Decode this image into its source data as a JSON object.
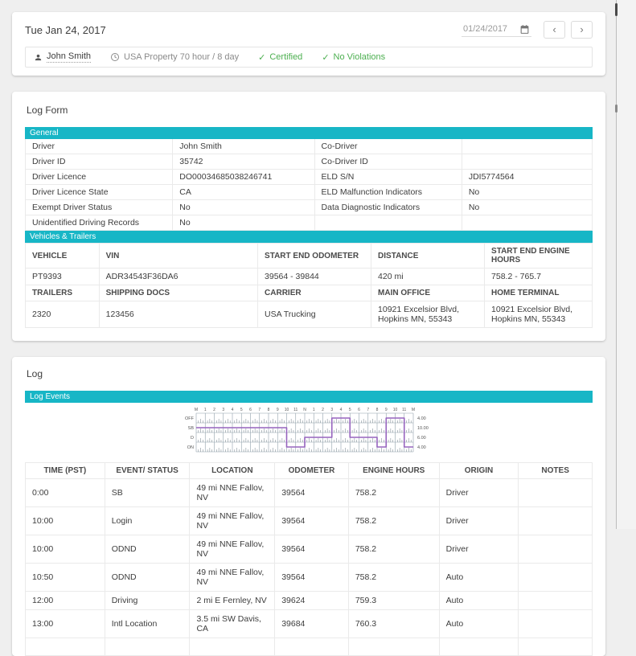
{
  "colors": {
    "teal": "#17b6c6",
    "green": "#4caf50",
    "graph_line": "#9664be"
  },
  "icons": {
    "prev": "‹",
    "next": "›",
    "check": "✓",
    "person": "person-icon",
    "clock": "clock-icon",
    "calendar": "calendar-icon"
  },
  "header": {
    "date_title": "Tue Jan 24, 2017",
    "date_input": "01/24/2017",
    "driver_name": "John Smith",
    "cycle": "USA Property 70 hour / 8 day",
    "certified": "Certified",
    "violations": "No Violations"
  },
  "log_form": {
    "title": "Log Form",
    "general": {
      "header": "General",
      "rows": [
        {
          "l1": "Driver",
          "v1": "John Smith",
          "l2": "Co-Driver",
          "v2": ""
        },
        {
          "l1": "Driver ID",
          "v1": "35742",
          "l2": "Co-Driver ID",
          "v2": ""
        },
        {
          "l1": "Driver Licence",
          "v1": "DO00034685038246741",
          "l2": "ELD S/N",
          "v2": "JDI5774564"
        },
        {
          "l1": "Driver Licence State",
          "v1": "CA",
          "l2": "ELD Malfunction Indicators",
          "v2": "No"
        },
        {
          "l1": "Exempt Driver Status",
          "v1": "No",
          "l2": "Data Diagnostic Indicators",
          "v2": "No"
        },
        {
          "l1": "Unidentified Driving Records",
          "v1": "No",
          "l2": "",
          "v2": ""
        }
      ]
    },
    "vehicles": {
      "header": "Vehicles & Trailers",
      "t1h": [
        "VEHICLE",
        "VIN",
        "START END ODOMETER",
        "DISTANCE",
        "START END ENGINE HOURS"
      ],
      "t1r": [
        "PT9393",
        "ADR34543F36DA6",
        "39564 - 39844",
        "420 mi",
        "758.2 - 765.7"
      ],
      "t2h": [
        "TRAILERS",
        "SHIPPING DOCS",
        "CARRIER",
        "MAIN OFFICE",
        "HOME TERMINAL"
      ],
      "t2r": [
        "2320",
        "123456",
        "USA Trucking",
        "10921 Excelsior Blvd, Hopkins MN, 55343",
        "10921 Excelsior Blvd, Hopkins MN, 55343"
      ]
    }
  },
  "log": {
    "title": "Log",
    "events_header": "Log Events",
    "chart_data": {
      "type": "duty-status-grid",
      "rows": [
        "OFF",
        "SB",
        "D",
        "ON"
      ],
      "row_totals": [
        "4.00",
        "10.00",
        "6.00",
        "4.00"
      ],
      "hour_labels": [
        "M",
        "1",
        "2",
        "3",
        "4",
        "5",
        "6",
        "7",
        "8",
        "9",
        "10",
        "11",
        "N",
        "1",
        "2",
        "3",
        "4",
        "5",
        "6",
        "7",
        "8",
        "9",
        "10",
        "11",
        "M"
      ],
      "segments": [
        {
          "status": "SB",
          "start": 0,
          "end": 10
        },
        {
          "status": "ON",
          "start": 10,
          "end": 12
        },
        {
          "status": "D",
          "start": 12,
          "end": 15
        },
        {
          "status": "OFF",
          "start": 15,
          "end": 17
        },
        {
          "status": "D",
          "start": 17,
          "end": 20
        },
        {
          "status": "ON",
          "start": 20,
          "end": 21
        },
        {
          "status": "OFF",
          "start": 21,
          "end": 23
        },
        {
          "status": "ON",
          "start": 23,
          "end": 24
        }
      ],
      "line_color": "#9664be"
    },
    "table": {
      "headers": [
        "TIME (PST)",
        "EVENT/ STATUS",
        "LOCATION",
        "ODOMETER",
        "ENGINE HOURS",
        "ORIGIN",
        "NOTES"
      ],
      "rows": [
        [
          "0:00",
          "SB",
          "49 mi NNE Fallov, NV",
          "39564",
          "758.2",
          "Driver",
          ""
        ],
        [
          "10:00",
          "Login",
          "49 mi NNE Fallov, NV",
          "39564",
          "758.2",
          "Driver",
          ""
        ],
        [
          "10:00",
          "ODND",
          "49 mi NNE Fallov, NV",
          "39564",
          "758.2",
          "Driver",
          ""
        ],
        [
          "10:50",
          "ODND",
          "49 mi NNE Fallov, NV",
          "39564",
          "758.2",
          "Auto",
          ""
        ],
        [
          "12:00",
          "Driving",
          "2 mi E Fernley, NV",
          "39624",
          "759.3",
          "Auto",
          ""
        ],
        [
          "13:00",
          "Intl Location",
          "3.5 mi SW Davis, CA",
          "39684",
          "760.3",
          "Auto",
          ""
        ]
      ]
    }
  }
}
